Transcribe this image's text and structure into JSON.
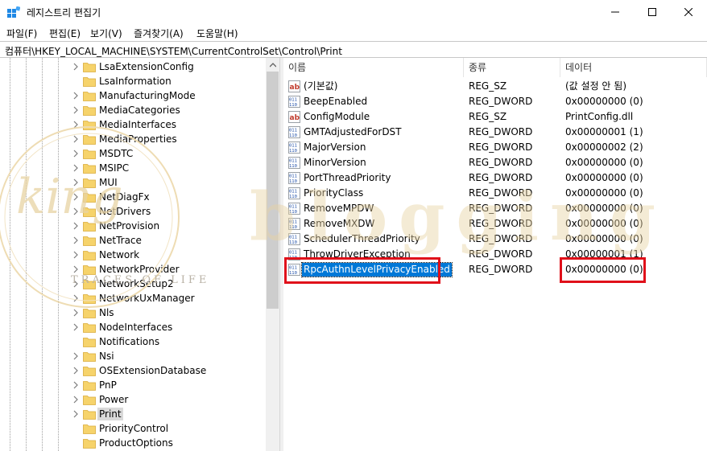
{
  "window": {
    "title": "레지스트리 편집기",
    "controls": {
      "minimize": "minimize",
      "maximize": "maximize",
      "close": "close"
    }
  },
  "menu": [
    "파일(F)",
    "편집(E)",
    "보기(V)",
    "즐겨찾기(A)",
    "도움말(H)"
  ],
  "address": "컴퓨터\\HKEY_LOCAL_MACHINE\\SYSTEM\\CurrentControlSet\\Control\\Print",
  "tree": {
    "items": [
      {
        "label": "LsaExtensionConfig",
        "expandable": true
      },
      {
        "label": "LsaInformation",
        "expandable": false
      },
      {
        "label": "ManufacturingMode",
        "expandable": true
      },
      {
        "label": "MediaCategories",
        "expandable": true
      },
      {
        "label": "MediaInterfaces",
        "expandable": true
      },
      {
        "label": "MediaProperties",
        "expandable": true
      },
      {
        "label": "MSDTC",
        "expandable": true
      },
      {
        "label": "MSIPC",
        "expandable": true
      },
      {
        "label": "MUI",
        "expandable": true
      },
      {
        "label": "NetDiagFx",
        "expandable": true
      },
      {
        "label": "NetDrivers",
        "expandable": true
      },
      {
        "label": "NetProvision",
        "expandable": true
      },
      {
        "label": "NetTrace",
        "expandable": true
      },
      {
        "label": "Network",
        "expandable": true
      },
      {
        "label": "NetworkProvider",
        "expandable": true
      },
      {
        "label": "NetworkSetup2",
        "expandable": true
      },
      {
        "label": "NetworkUxManager",
        "expandable": true
      },
      {
        "label": "Nls",
        "expandable": true
      },
      {
        "label": "NodeInterfaces",
        "expandable": true
      },
      {
        "label": "Notifications",
        "expandable": false
      },
      {
        "label": "Nsi",
        "expandable": true
      },
      {
        "label": "OSExtensionDatabase",
        "expandable": true
      },
      {
        "label": "PnP",
        "expandable": true
      },
      {
        "label": "Power",
        "expandable": true
      },
      {
        "label": "Print",
        "expandable": true,
        "selected": true
      },
      {
        "label": "PriorityControl",
        "expandable": false
      },
      {
        "label": "ProductOptions",
        "expandable": false
      }
    ]
  },
  "list": {
    "columns": [
      "이름",
      "종류",
      "데이터"
    ],
    "rows": [
      {
        "name": "(기본값)",
        "type": "REG_SZ",
        "data": "(값 설정 안 됨)",
        "icon": "string-value-icon"
      },
      {
        "name": "BeepEnabled",
        "type": "REG_DWORD",
        "data": "0x00000000 (0)",
        "icon": "binary-value-icon"
      },
      {
        "name": "ConfigModule",
        "type": "REG_SZ",
        "data": "PrintConfig.dll",
        "icon": "string-value-icon"
      },
      {
        "name": "GMTAdjustedForDST",
        "type": "REG_DWORD",
        "data": "0x00000001 (1)",
        "icon": "binary-value-icon"
      },
      {
        "name": "MajorVersion",
        "type": "REG_DWORD",
        "data": "0x00000002 (2)",
        "icon": "binary-value-icon"
      },
      {
        "name": "MinorVersion",
        "type": "REG_DWORD",
        "data": "0x00000000 (0)",
        "icon": "binary-value-icon"
      },
      {
        "name": "PortThreadPriority",
        "type": "REG_DWORD",
        "data": "0x00000000 (0)",
        "icon": "binary-value-icon"
      },
      {
        "name": "PriorityClass",
        "type": "REG_DWORD",
        "data": "0x00000000 (0)",
        "icon": "binary-value-icon"
      },
      {
        "name": "RemoveMPDW",
        "type": "REG_DWORD",
        "data": "0x00000000 (0)",
        "icon": "binary-value-icon"
      },
      {
        "name": "RemoveMXDW",
        "type": "REG_DWORD",
        "data": "0x00000000 (0)",
        "icon": "binary-value-icon"
      },
      {
        "name": "SchedulerThreadPriority",
        "type": "REG_DWORD",
        "data": "0x00000000 (0)",
        "icon": "binary-value-icon"
      },
      {
        "name": "ThrowDriverException",
        "type": "REG_DWORD",
        "data": "0x00000001 (1)",
        "icon": "binary-value-icon"
      },
      {
        "name": "RpcAuthnLevelPrivacyEnabled",
        "type": "REG_DWORD",
        "data": "0x00000000 (0)",
        "icon": "binary-value-icon",
        "selected": true
      }
    ]
  },
  "watermark": {
    "script": "king",
    "text": "TRACES OF LIFE",
    "brand": "blogging"
  },
  "colors": {
    "selection": "#0078d7",
    "highlight_box": "#e0101a",
    "watermark": "#e8d3a3",
    "folder": "#f6d36b"
  }
}
